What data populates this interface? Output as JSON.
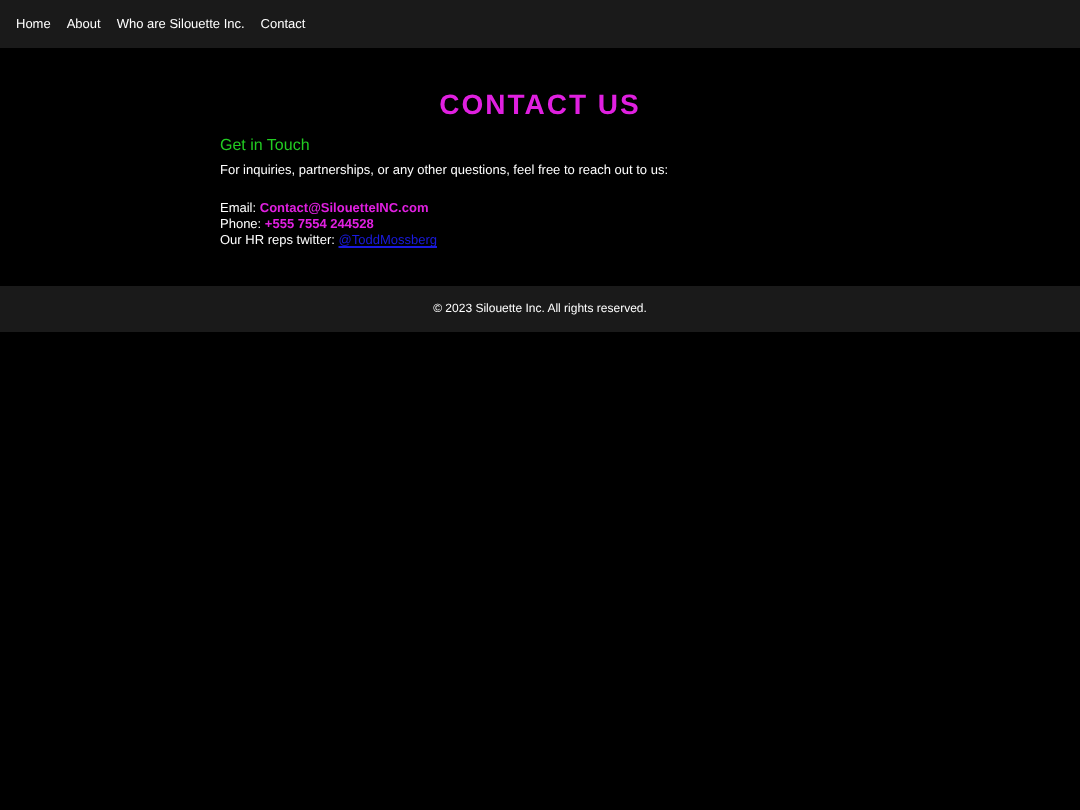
{
  "nav": [
    {
      "label": "Home"
    },
    {
      "label": "About"
    },
    {
      "label": "Who are Silouette Inc."
    },
    {
      "label": "Contact"
    }
  ],
  "heading": "CONTACT US",
  "subheading": "Get in Touch",
  "intro": "For inquiries, partnerships, or any other questions, feel free to reach out to us:",
  "contacts": [
    {
      "kind": "text",
      "label": "Email:",
      "value": "Contact@SilouetteINC.com"
    },
    {
      "kind": "text",
      "label": "Phone:",
      "value": "+555 7554 244528"
    },
    {
      "kind": "link",
      "label": "Our HR reps twitter:",
      "value": "@ToddMossberg"
    }
  ],
  "footer": "© 2023 Silouette Inc. All rights reserved."
}
